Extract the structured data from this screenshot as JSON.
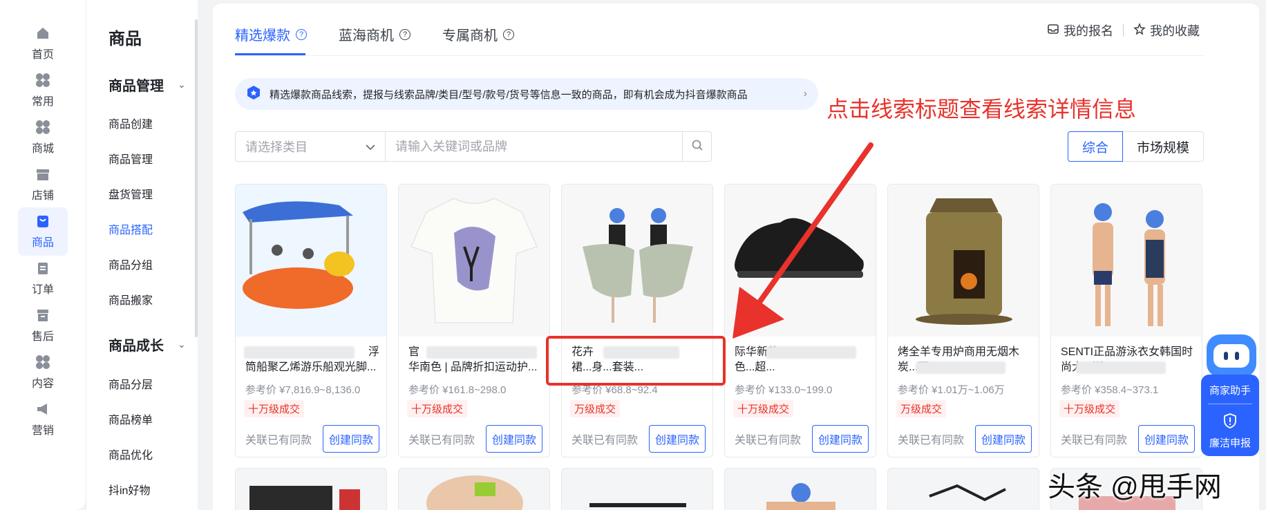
{
  "rail": {
    "items": [
      {
        "label": "首页",
        "icon": "home-icon"
      },
      {
        "label": "常用",
        "icon": "grid-icon"
      },
      {
        "label": "商城",
        "icon": "grid-icon"
      },
      {
        "label": "店铺",
        "icon": "store-icon"
      },
      {
        "label": "商品",
        "icon": "bag-icon",
        "active": true
      },
      {
        "label": "订单",
        "icon": "clipboard-icon"
      },
      {
        "label": "售后",
        "icon": "box-icon"
      },
      {
        "label": "内容",
        "icon": "grid-icon"
      },
      {
        "label": "营销",
        "icon": "megaphone-icon"
      }
    ]
  },
  "submenu": {
    "title": "商品",
    "group1": "商品管理",
    "group1_items": [
      "商品创建",
      "商品管理",
      "盘货管理",
      "商品搭配",
      "商品分组",
      "商品搬家"
    ],
    "group2": "商品成长",
    "group2_items": [
      "商品分层",
      "商品榜单",
      "商品优化",
      "抖in好物"
    ]
  },
  "tabs": [
    {
      "label": "精选爆款",
      "active": true
    },
    {
      "label": "蓝海商机"
    },
    {
      "label": "专属商机"
    }
  ],
  "top_links": {
    "registration": "我的报名",
    "favorites": "我的收藏"
  },
  "notice": "精选爆款商品线索，提报与线索品牌/类目/型号/款号/货号等信息一致的商品，即有机会成为抖音爆款商品",
  "annotation": "点击线索标题查看线索详情信息",
  "filters": {
    "category_placeholder": "请选择类目",
    "keyword_placeholder": "请输入关键词或品牌"
  },
  "sort": {
    "comprehensive": "综合",
    "market_size": "市场规模"
  },
  "products": [
    {
      "title_a": "浮",
      "title_b": "筒船聚乙烯游乐船观光脚...",
      "price": "参考价 ¥7,816.9~8,136.0",
      "badge": "十万级成交",
      "linked": "关联已有同款",
      "button": "创建同款"
    },
    {
      "title_a": "官",
      "title_b": "华南色 | 品牌折扣运动护...",
      "price": "参考价 ¥161.8~298.0",
      "badge": "十万级成交",
      "linked": "关联已有同款",
      "button": "创建同款"
    },
    {
      "title_a": "花卉",
      "title_b": "裙...身...套装...",
      "price": "参考价 ¥68.8~92.4",
      "badge": "万级成交",
      "linked": "关联已有同款",
      "button": "创建同款"
    },
    {
      "title_a": "际华新款",
      "title_b": "色...超...",
      "price": "参考价 ¥133.0~199.0",
      "badge": "十万级成交",
      "linked": "关联已有同款",
      "button": "创建同款"
    },
    {
      "title_a": "烤全羊专用炉商用无烟木",
      "title_b": "炭...两...",
      "price": "参考价 ¥1.01万~1.06万",
      "badge": "万级成交",
      "linked": "关联已有同款",
      "button": "创建同款"
    },
    {
      "title_a": "SENTI正品游泳衣女韩国时",
      "title_b": "尚大...训...",
      "price": "参考价 ¥358.4~373.1",
      "badge": "十万级成交",
      "linked": "关联已有同款",
      "button": "创建同款"
    }
  ],
  "assistant": {
    "helper": "商家助手",
    "report": "廉洁申报"
  },
  "watermark": "头条 @甩手网",
  "colors": {
    "accent": "#2a63ff",
    "danger": "#e8322b"
  }
}
